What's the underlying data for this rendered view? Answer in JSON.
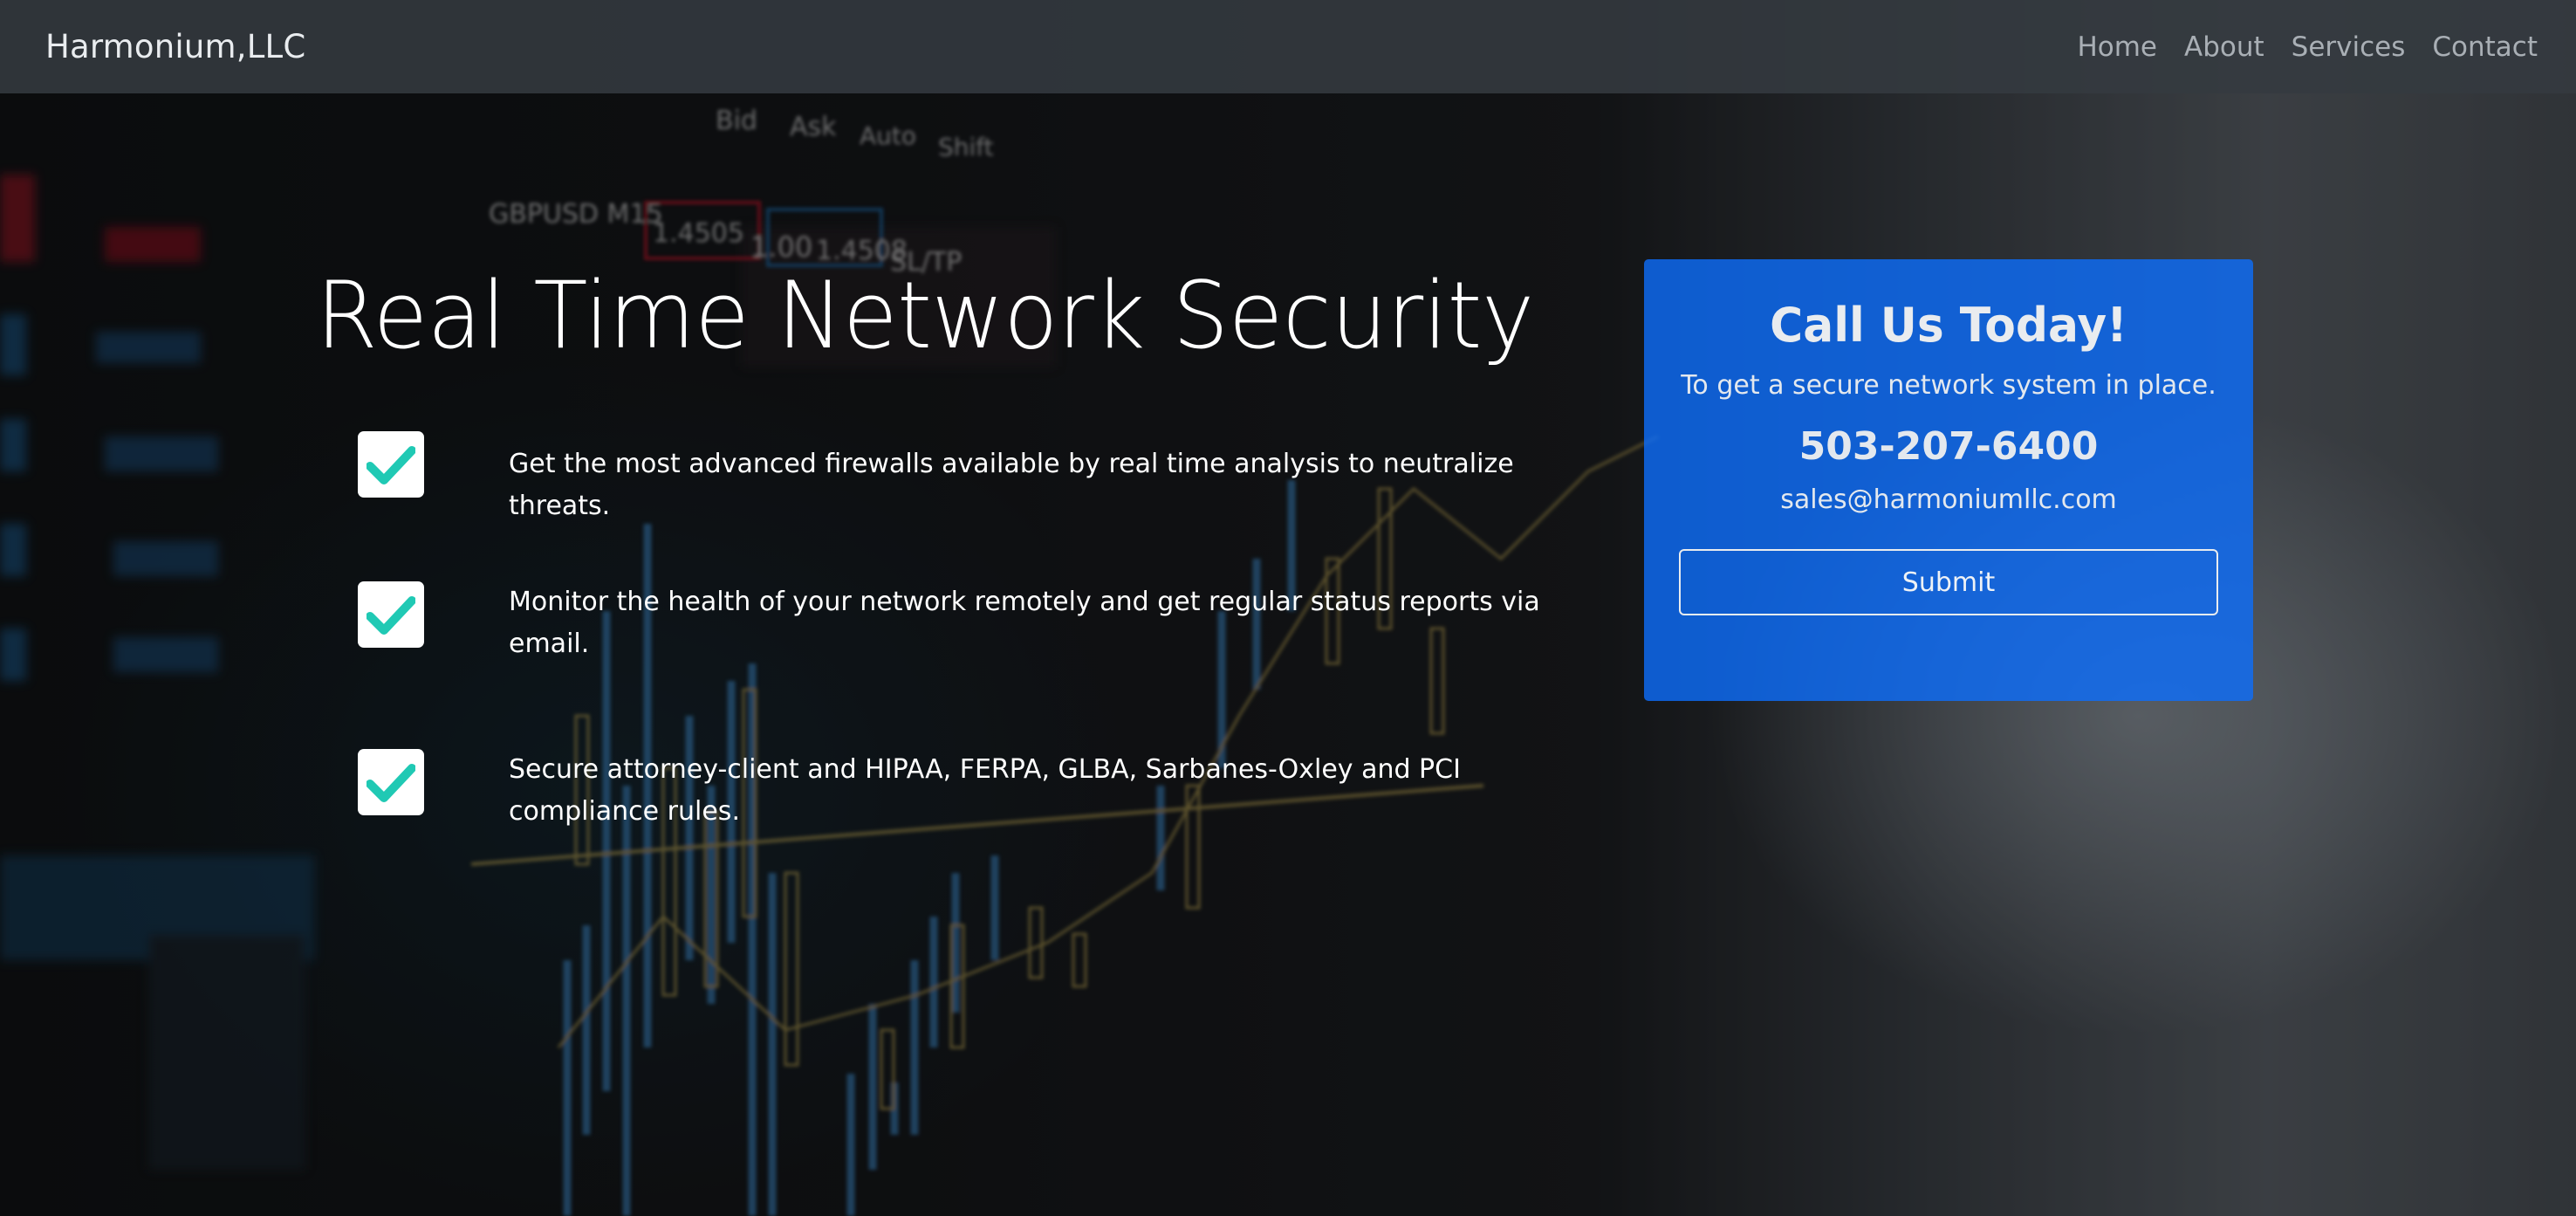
{
  "navbar": {
    "brand": "Harmonium,LLC",
    "links": [
      "Home",
      "About",
      "Services",
      "Contact"
    ]
  },
  "hero": {
    "title": "Real Time Network Security",
    "features": [
      "Get the most advanced firewalls available by real time analysis to neutralize threats.",
      "Monitor the health of your network remotely and get regular status reports via email.",
      "Secure attorney-client and HIPAA, FERPA, GLBA, Sarbanes-Oxley and PCI compliance rules."
    ],
    "check_icon": "check-icon",
    "check_color": "#20c9b4"
  },
  "cta": {
    "title": "Call Us Today!",
    "subtitle": "To get a secure network system in place.",
    "phone": "503-207-6400",
    "email": "sales@harmoniumllc.com",
    "submit_label": "Submit",
    "background_color": "#0d6efd"
  },
  "background": {
    "ticker_labels": [
      "Bid",
      "Ask",
      "Auto",
      "Shift",
      "GBPUSD M15",
      "1.4505",
      "1.00",
      "1.4508",
      "SL/TP"
    ]
  }
}
